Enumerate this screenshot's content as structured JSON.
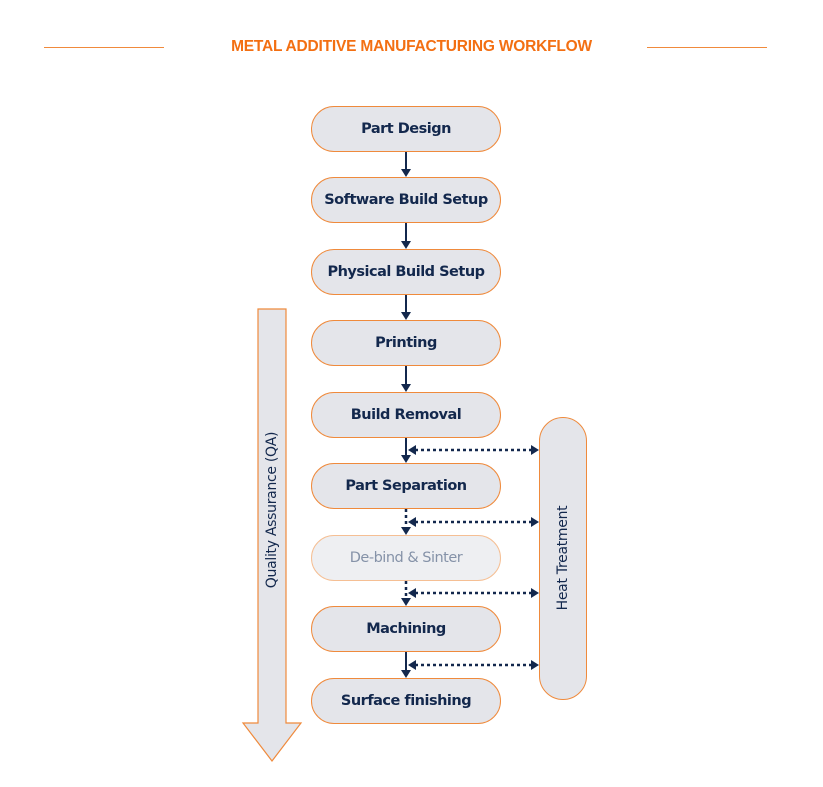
{
  "title": "METAL ADDITIVE MANUFACTURING WORKFLOW",
  "colors": {
    "accent": "#f36f12",
    "node_border": "#ef8a3c",
    "node_fill": "#e4e5ea",
    "text_dark": "#13284d",
    "connector": "#13284d"
  },
  "steps": [
    {
      "label": "Part Design",
      "faded": false
    },
    {
      "label": "Software Build Setup",
      "faded": false
    },
    {
      "label": "Physical Build Setup",
      "faded": false
    },
    {
      "label": "Printing",
      "faded": false
    },
    {
      "label": "Build Removal",
      "faded": false
    },
    {
      "label": "Part Separation",
      "faded": false
    },
    {
      "label": "De-bind & Sinter",
      "faded": true
    },
    {
      "label": "Machining",
      "faded": false
    },
    {
      "label": "Surface finishing",
      "faded": false
    }
  ],
  "side_process": {
    "label": "Heat Treatment"
  },
  "qa_arrow": {
    "label": "Quality Assurance (QA)"
  }
}
